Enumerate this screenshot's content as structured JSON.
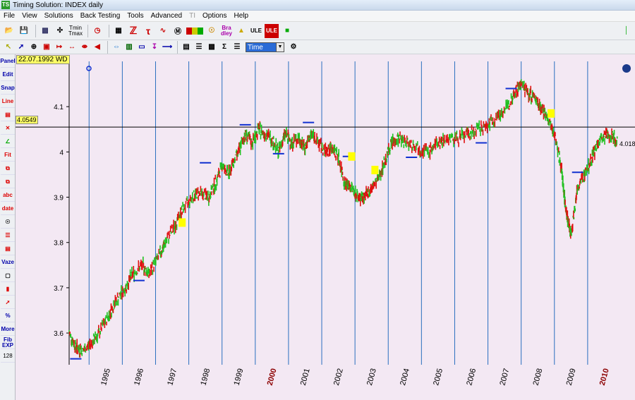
{
  "window": {
    "title": "Timing Solution:  INDEX  daily",
    "app_icon": "TS"
  },
  "menu": [
    "File",
    "View",
    "Solutions",
    "Back Testing",
    "Tools",
    "Advanced",
    "TI",
    "Options",
    "Help"
  ],
  "menu_disabled": [
    "TI"
  ],
  "toolbar1": {
    "tmin_label": "Tmin",
    "tmax_label": "Tmax",
    "bra_label": "Bra",
    "dley_label": "dley",
    "ule_label": "ULE",
    "ule2_label": "ULE"
  },
  "toolbar2": {
    "time_select": "Time"
  },
  "leftbar": {
    "panel": "Panel",
    "edit": "Edit",
    "snap": "Snap",
    "line": "Line",
    "fit": "Fit",
    "abc": "abc",
    "date": "date",
    "vaze": "Vaze",
    "more": "More",
    "fib": "Fib",
    "exp": "EXP",
    "n128": "128"
  },
  "cursor": {
    "date": "22.07.1992 WD",
    "price": "4.0549",
    "last_value": "4.018"
  },
  "chart_data": {
    "type": "line",
    "title": "",
    "xlabel": "",
    "ylabel": "",
    "ylim": [
      3.53,
      4.2
    ],
    "y_ticks": [
      "3.6",
      "3.7",
      "3.8",
      "3.9",
      "4",
      "4.1"
    ],
    "x_ticks": [
      "1995",
      "1996",
      "1997",
      "1998",
      "1999",
      "2000",
      "2001",
      "2002",
      "2003",
      "2004",
      "2005",
      "2006",
      "2007",
      "2008",
      "2009",
      "2010"
    ],
    "x_ticks_highlight": [
      "2000",
      "2010"
    ],
    "xlim": [
      1994.1,
      2010.7
    ],
    "horizontal_line": 4.0549,
    "series": [
      {
        "x": [
          1994.1,
          1994.3,
          1994.5,
          1994.8,
          1995.0,
          1995.3,
          1995.5,
          1995.8,
          1996.0,
          1996.3,
          1996.5,
          1996.8,
          1997.0,
          1997.3,
          1997.5,
          1997.8,
          1998.0,
          1998.3,
          1998.5,
          1998.7,
          1998.9,
          1999.0,
          1999.2,
          1999.4,
          1999.6,
          1999.8,
          2000.0,
          2000.2,
          2000.4,
          2000.6,
          2000.8,
          2001.0,
          2001.2,
          2001.4,
          2001.6,
          2001.8,
          2002.0,
          2002.2,
          2002.4,
          2002.6,
          2002.8,
          2003.0,
          2003.2,
          2003.4,
          2003.6,
          2003.8,
          2004.0,
          2004.3,
          2004.6,
          2004.9,
          2005.2,
          2005.5,
          2005.8,
          2006.1,
          2006.4,
          2006.7,
          2007.0,
          2007.3,
          2007.5,
          2007.7,
          2007.9,
          2008.1,
          2008.3,
          2008.5,
          2008.7,
          2008.9,
          2009.0,
          2009.1,
          2009.2,
          2009.4,
          2009.6,
          2009.8,
          2010.0,
          2010.2,
          2010.4,
          2010.6
        ],
        "y": [
          3.6,
          3.57,
          3.56,
          3.58,
          3.6,
          3.64,
          3.67,
          3.7,
          3.73,
          3.75,
          3.73,
          3.77,
          3.8,
          3.84,
          3.87,
          3.9,
          3.91,
          3.9,
          3.93,
          3.97,
          3.95,
          3.97,
          4.0,
          4.04,
          4.02,
          4.05,
          4.04,
          4.03,
          4.0,
          4.04,
          4.02,
          4.03,
          4.01,
          4.04,
          4.02,
          4.0,
          4.01,
          3.99,
          3.93,
          3.92,
          3.9,
          3.9,
          3.92,
          3.94,
          3.98,
          4.02,
          4.03,
          4.02,
          4.01,
          4.0,
          4.02,
          4.03,
          4.03,
          4.04,
          4.05,
          4.06,
          4.08,
          4.1,
          4.13,
          4.15,
          4.13,
          4.12,
          4.1,
          4.07,
          4.04,
          3.97,
          3.9,
          3.85,
          3.82,
          3.92,
          3.95,
          3.98,
          4.02,
          4.03,
          4.04,
          4.02
        ]
      }
    ],
    "markers_blue": [
      [
        1994.3,
        3.543
      ],
      [
        1996.2,
        3.716
      ],
      [
        1998.2,
        3.976
      ],
      [
        1999.4,
        4.06
      ],
      [
        2000.4,
        3.996
      ],
      [
        2001.3,
        4.065
      ],
      [
        2002.5,
        3.99
      ],
      [
        2004.4,
        3.988
      ],
      [
        2006.5,
        4.02
      ],
      [
        2007.4,
        4.14
      ],
      [
        2009.4,
        3.955
      ]
    ],
    "markers_yellow": [
      [
        1997.5,
        3.844
      ],
      [
        2002.6,
        3.99
      ],
      [
        2003.3,
        3.96
      ],
      [
        2008.6,
        4.085
      ]
    ]
  }
}
